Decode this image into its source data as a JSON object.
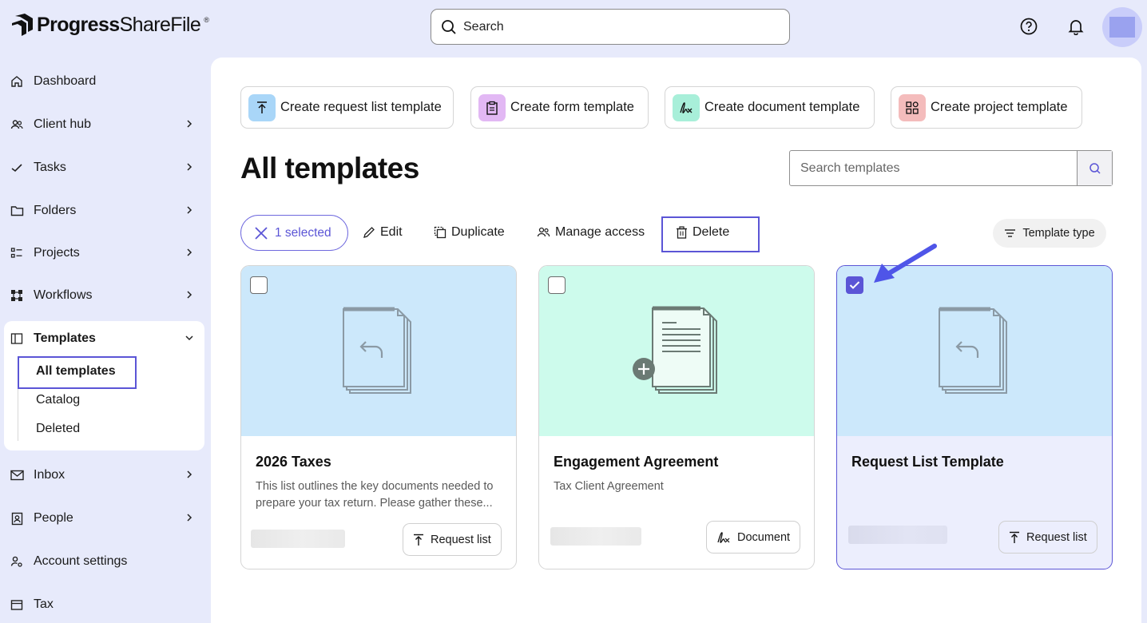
{
  "header": {
    "logo_brand": "Progress",
    "logo_product": "ShareFile",
    "search_placeholder": "Search",
    "help_icon": "help-circle-icon",
    "bell_icon": "bell-icon"
  },
  "sidebar": {
    "items": [
      {
        "label": "Dashboard",
        "icon": "home-icon",
        "chevron": false
      },
      {
        "label": "Client hub",
        "icon": "users-icon",
        "chevron": true
      },
      {
        "label": "Tasks",
        "icon": "checkmark-icon",
        "chevron": true
      },
      {
        "label": "Folders",
        "icon": "folder-icon",
        "chevron": true
      },
      {
        "label": "Projects",
        "icon": "projects-icon",
        "chevron": true
      },
      {
        "label": "Workflows",
        "icon": "workflow-icon",
        "chevron": true
      },
      {
        "label": "Templates",
        "icon": "templates-icon",
        "chevron": true
      },
      {
        "label": "Inbox",
        "icon": "mail-icon",
        "chevron": true
      },
      {
        "label": "People",
        "icon": "contact-card-icon",
        "chevron": true
      },
      {
        "label": "Account settings",
        "icon": "user-gear-icon",
        "chevron": false
      },
      {
        "label": "Tax",
        "icon": "tax-icon",
        "chevron": false
      }
    ],
    "templates_sub": [
      "All templates",
      "Catalog",
      "Deleted"
    ]
  },
  "create_buttons": [
    {
      "label": "Create request list template",
      "color": "#a9d6f8",
      "icon": "upload-icon"
    },
    {
      "label": "Create form template",
      "color": "#e2b8f4",
      "icon": "clipboard-icon"
    },
    {
      "label": "Create document template",
      "color": "#a8efd9",
      "icon": "signature-icon"
    },
    {
      "label": "Create project template",
      "color": "#f4bcbc",
      "icon": "shapes-icon"
    }
  ],
  "page_title": "All templates",
  "search_templates_placeholder": "Search templates",
  "toolbar": {
    "selected_label": "1 selected",
    "edit": "Edit",
    "duplicate": "Duplicate",
    "manage_access": "Manage access",
    "delete": "Delete",
    "template_type": "Template type"
  },
  "cards": [
    {
      "title": "2026 Taxes",
      "desc": "This list outlines the key documents needed to prepare your tax return. Please gather these...",
      "type": "Request list",
      "checked": false,
      "bg": "#cce8fb"
    },
    {
      "title": "Engagement Agreement",
      "desc": "Tax Client Agreement",
      "type": "Document",
      "checked": false,
      "bg": "#cdfbec"
    },
    {
      "title": "Request List Template",
      "desc": "",
      "type": "Request list",
      "checked": true,
      "bg": "#cce8fb"
    }
  ],
  "colors": {
    "accent": "#5b55d6",
    "sidebar_bg": "#e7eafb"
  }
}
